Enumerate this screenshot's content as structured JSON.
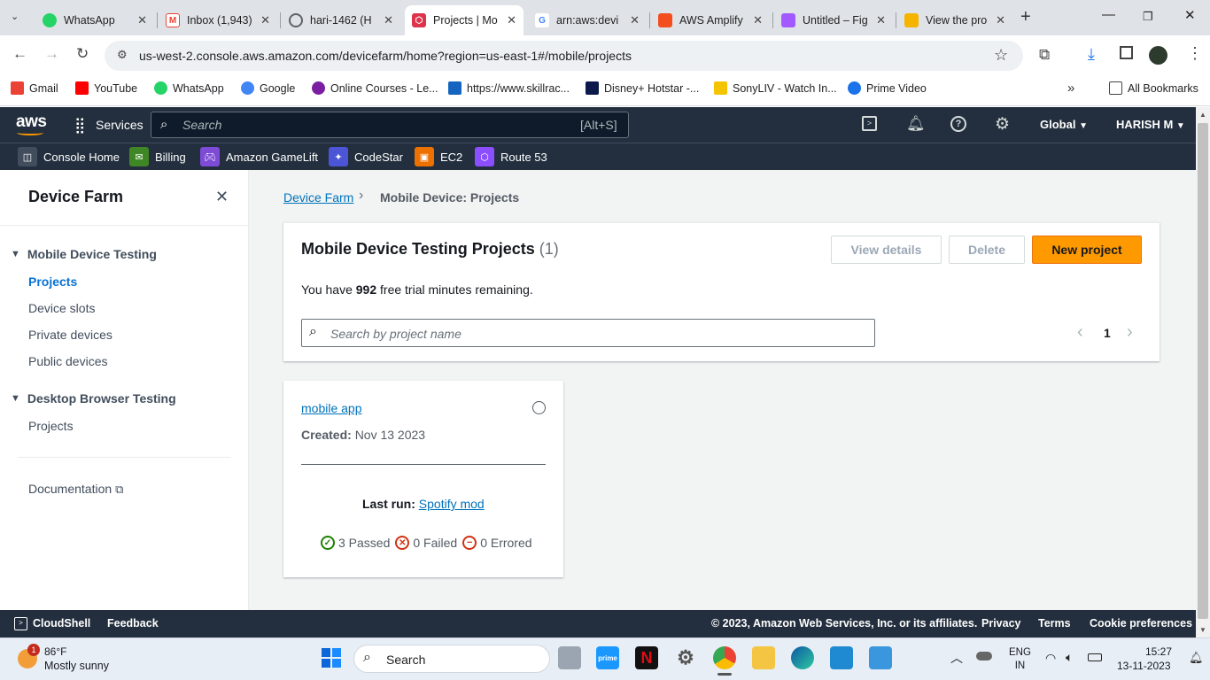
{
  "browser": {
    "tabs": [
      {
        "title": "WhatsApp",
        "fav_color": "#25d366"
      },
      {
        "title": "Inbox (1,943)",
        "fav_color": "#ea4335"
      },
      {
        "title": "hari-1462 (H",
        "fav_color": "#5f6368"
      },
      {
        "title": "Projects | Mo",
        "fav_color": "#dd344c",
        "active": true
      },
      {
        "title": "arn:aws:devi",
        "fav_color": "#4285f4"
      },
      {
        "title": "AWS Amplify",
        "fav_color": "#f24e1e"
      },
      {
        "title": "Untitled – Fig",
        "fav_color": "#a259ff"
      },
      {
        "title": "View the pro",
        "fav_color": "#f4b400"
      }
    ],
    "url": "us-west-2.console.aws.amazon.com/devicefarm/home?region=us-east-1#/mobile/projects",
    "bookmarks": [
      {
        "label": "Gmail",
        "color": "#ea4335"
      },
      {
        "label": "YouTube",
        "color": "#ff0000"
      },
      {
        "label": "WhatsApp",
        "color": "#25d366"
      },
      {
        "label": "Google",
        "color": "#4285f4"
      },
      {
        "label": "Online Courses - Le...",
        "color": "#7b1fa2"
      },
      {
        "label": "https://www.skillrac...",
        "color": "#1565c0"
      },
      {
        "label": "Disney+ Hotstar -...",
        "color": "#0c1a4b"
      },
      {
        "label": "SonyLIV - Watch In...",
        "color": "#f5c400"
      },
      {
        "label": "Prime Video",
        "color": "#1a73e8"
      }
    ],
    "all_bookmarks": "All Bookmarks"
  },
  "aws": {
    "logo": "aws",
    "services": "Services",
    "search_placeholder": "Search",
    "search_shortcut": "[Alt+S]",
    "region": "Global",
    "user": "HARISH M",
    "favorites": [
      {
        "label": "Console Home",
        "color": "#414d5c"
      },
      {
        "label": "Billing",
        "color": "#3f8624"
      },
      {
        "label": "Amazon GameLift",
        "color": "#7d4bd6"
      },
      {
        "label": "CodeStar",
        "color": "#4c55d6"
      },
      {
        "label": "EC2",
        "color": "#ed7100"
      },
      {
        "label": "Route 53",
        "color": "#8c4fff"
      }
    ]
  },
  "sidebar": {
    "title": "Device Farm",
    "section1": "Mobile Device Testing",
    "items1": [
      "Projects",
      "Device slots",
      "Private devices",
      "Public devices"
    ],
    "section2": "Desktop Browser Testing",
    "items2": [
      "Projects"
    ],
    "documentation": "Documentation"
  },
  "main": {
    "breadcrumb": [
      "Device Farm",
      "Mobile Device: Projects"
    ],
    "panel_title": "Mobile Device Testing Projects",
    "count": "(1)",
    "view_details": "View details",
    "delete": "Delete",
    "new_project": "New project",
    "trial_prefix": "You have",
    "trial_minutes": "992",
    "trial_suffix": "free trial minutes remaining.",
    "search_placeholder": "Search by project name",
    "page": "1",
    "card": {
      "name": "mobile app",
      "created_label": "Created:",
      "created_value": "Nov 13 2023",
      "last_run_label": "Last run:",
      "last_run_value": "Spotify mod",
      "passed": "3 Passed",
      "failed": "0 Failed",
      "errored": "0 Errored"
    }
  },
  "footer": {
    "cloudshell": "CloudShell",
    "feedback": "Feedback",
    "copyright": "© 2023, Amazon Web Services, Inc. or its affiliates.",
    "privacy": "Privacy",
    "terms": "Terms",
    "cookies": "Cookie preferences"
  },
  "taskbar": {
    "temp": "86°F",
    "weather": "Mostly sunny",
    "badge": "1",
    "search": "Search",
    "lang1": "ENG",
    "lang2": "IN",
    "time": "15:27",
    "date": "13-11-2023"
  }
}
